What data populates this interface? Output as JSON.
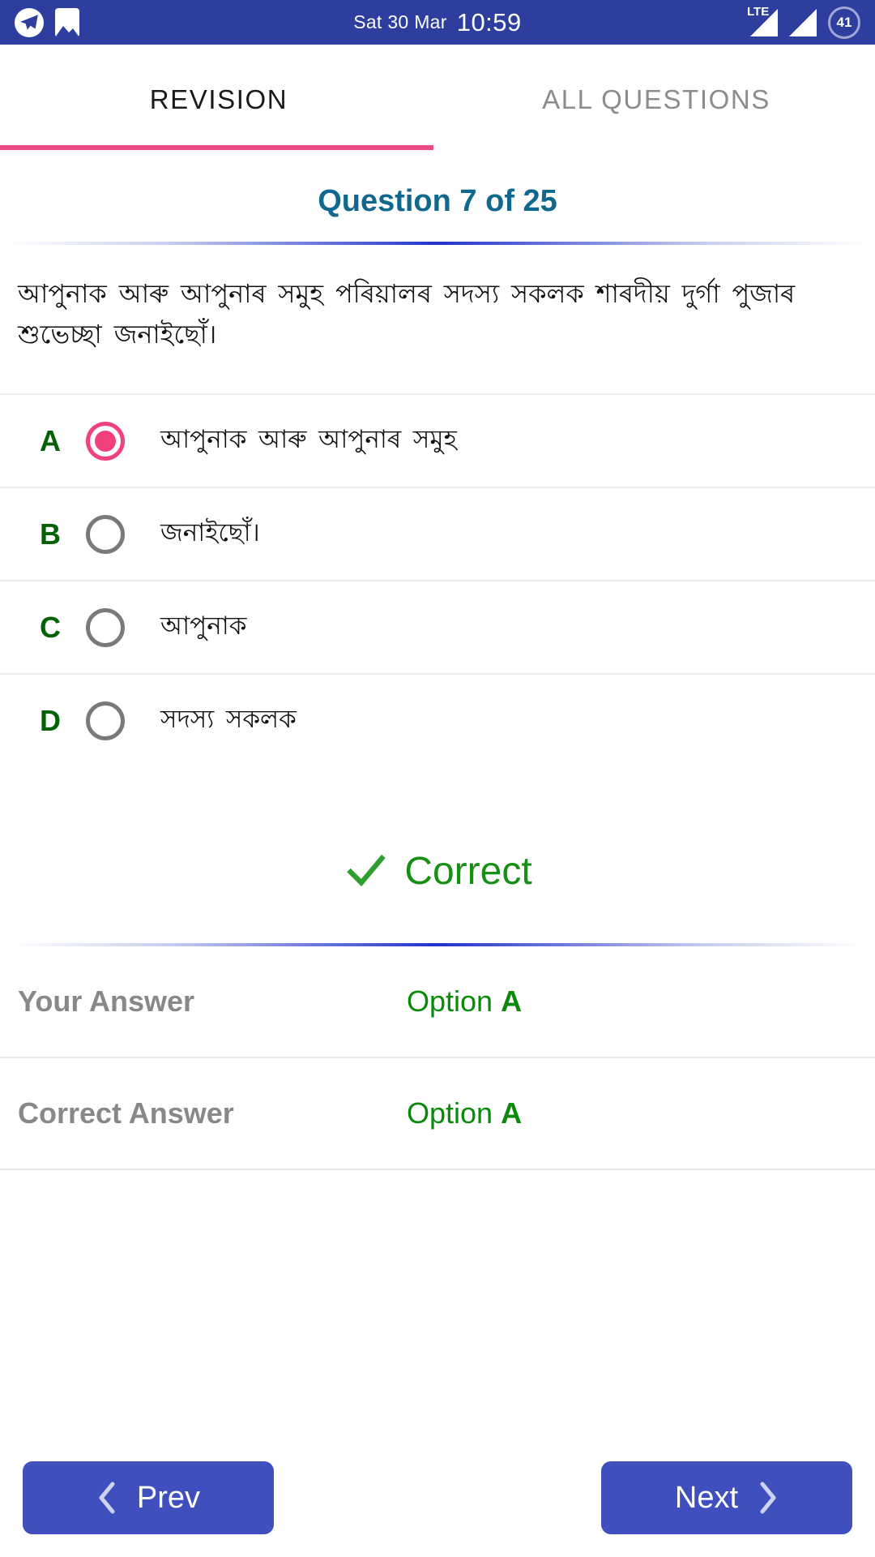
{
  "statusbar": {
    "icons_left": [
      "telegram-icon",
      "photo-icon"
    ],
    "date": "Sat 30 Mar",
    "time": "10:59",
    "network_label": "LTE",
    "battery_level": "41",
    "background_color": "#2E3E9E"
  },
  "tabs": {
    "items": [
      {
        "label": "REVISION",
        "active": true
      },
      {
        "label": "ALL QUESTIONS",
        "active": false
      }
    ],
    "indicator_color": "#EC4A84"
  },
  "question": {
    "header": "Question 7 of 25",
    "header_color": "#10688F",
    "text": "আপুনাক আৰু আপুনাৰ সমুহ পৰিয়ালৰ সদস্য সকলক শাৰদীয় দুৰ্গা পুজাৰ শুভেচ্ছা জনাইছোঁ।"
  },
  "options": [
    {
      "letter": "A",
      "text": "আপুনাক আৰু আপুনাৰ সমুহ",
      "selected": true
    },
    {
      "letter": "B",
      "text": "জনাইছোঁ।",
      "selected": false
    },
    {
      "letter": "C",
      "text": "আপুনাক",
      "selected": false
    },
    {
      "letter": "D",
      "text": "সদস্য সকলক",
      "selected": false
    }
  ],
  "result": {
    "icon": "check-icon",
    "label": "Correct",
    "color": "#159015"
  },
  "answers": [
    {
      "label": "Your Answer",
      "value_prefix": "Option ",
      "value_letter": "A"
    },
    {
      "label": "Correct Answer",
      "value_prefix": "Option ",
      "value_letter": "A"
    }
  ],
  "nav": {
    "prev_label": "Prev",
    "next_label": "Next",
    "button_color": "#3F4FBE"
  }
}
